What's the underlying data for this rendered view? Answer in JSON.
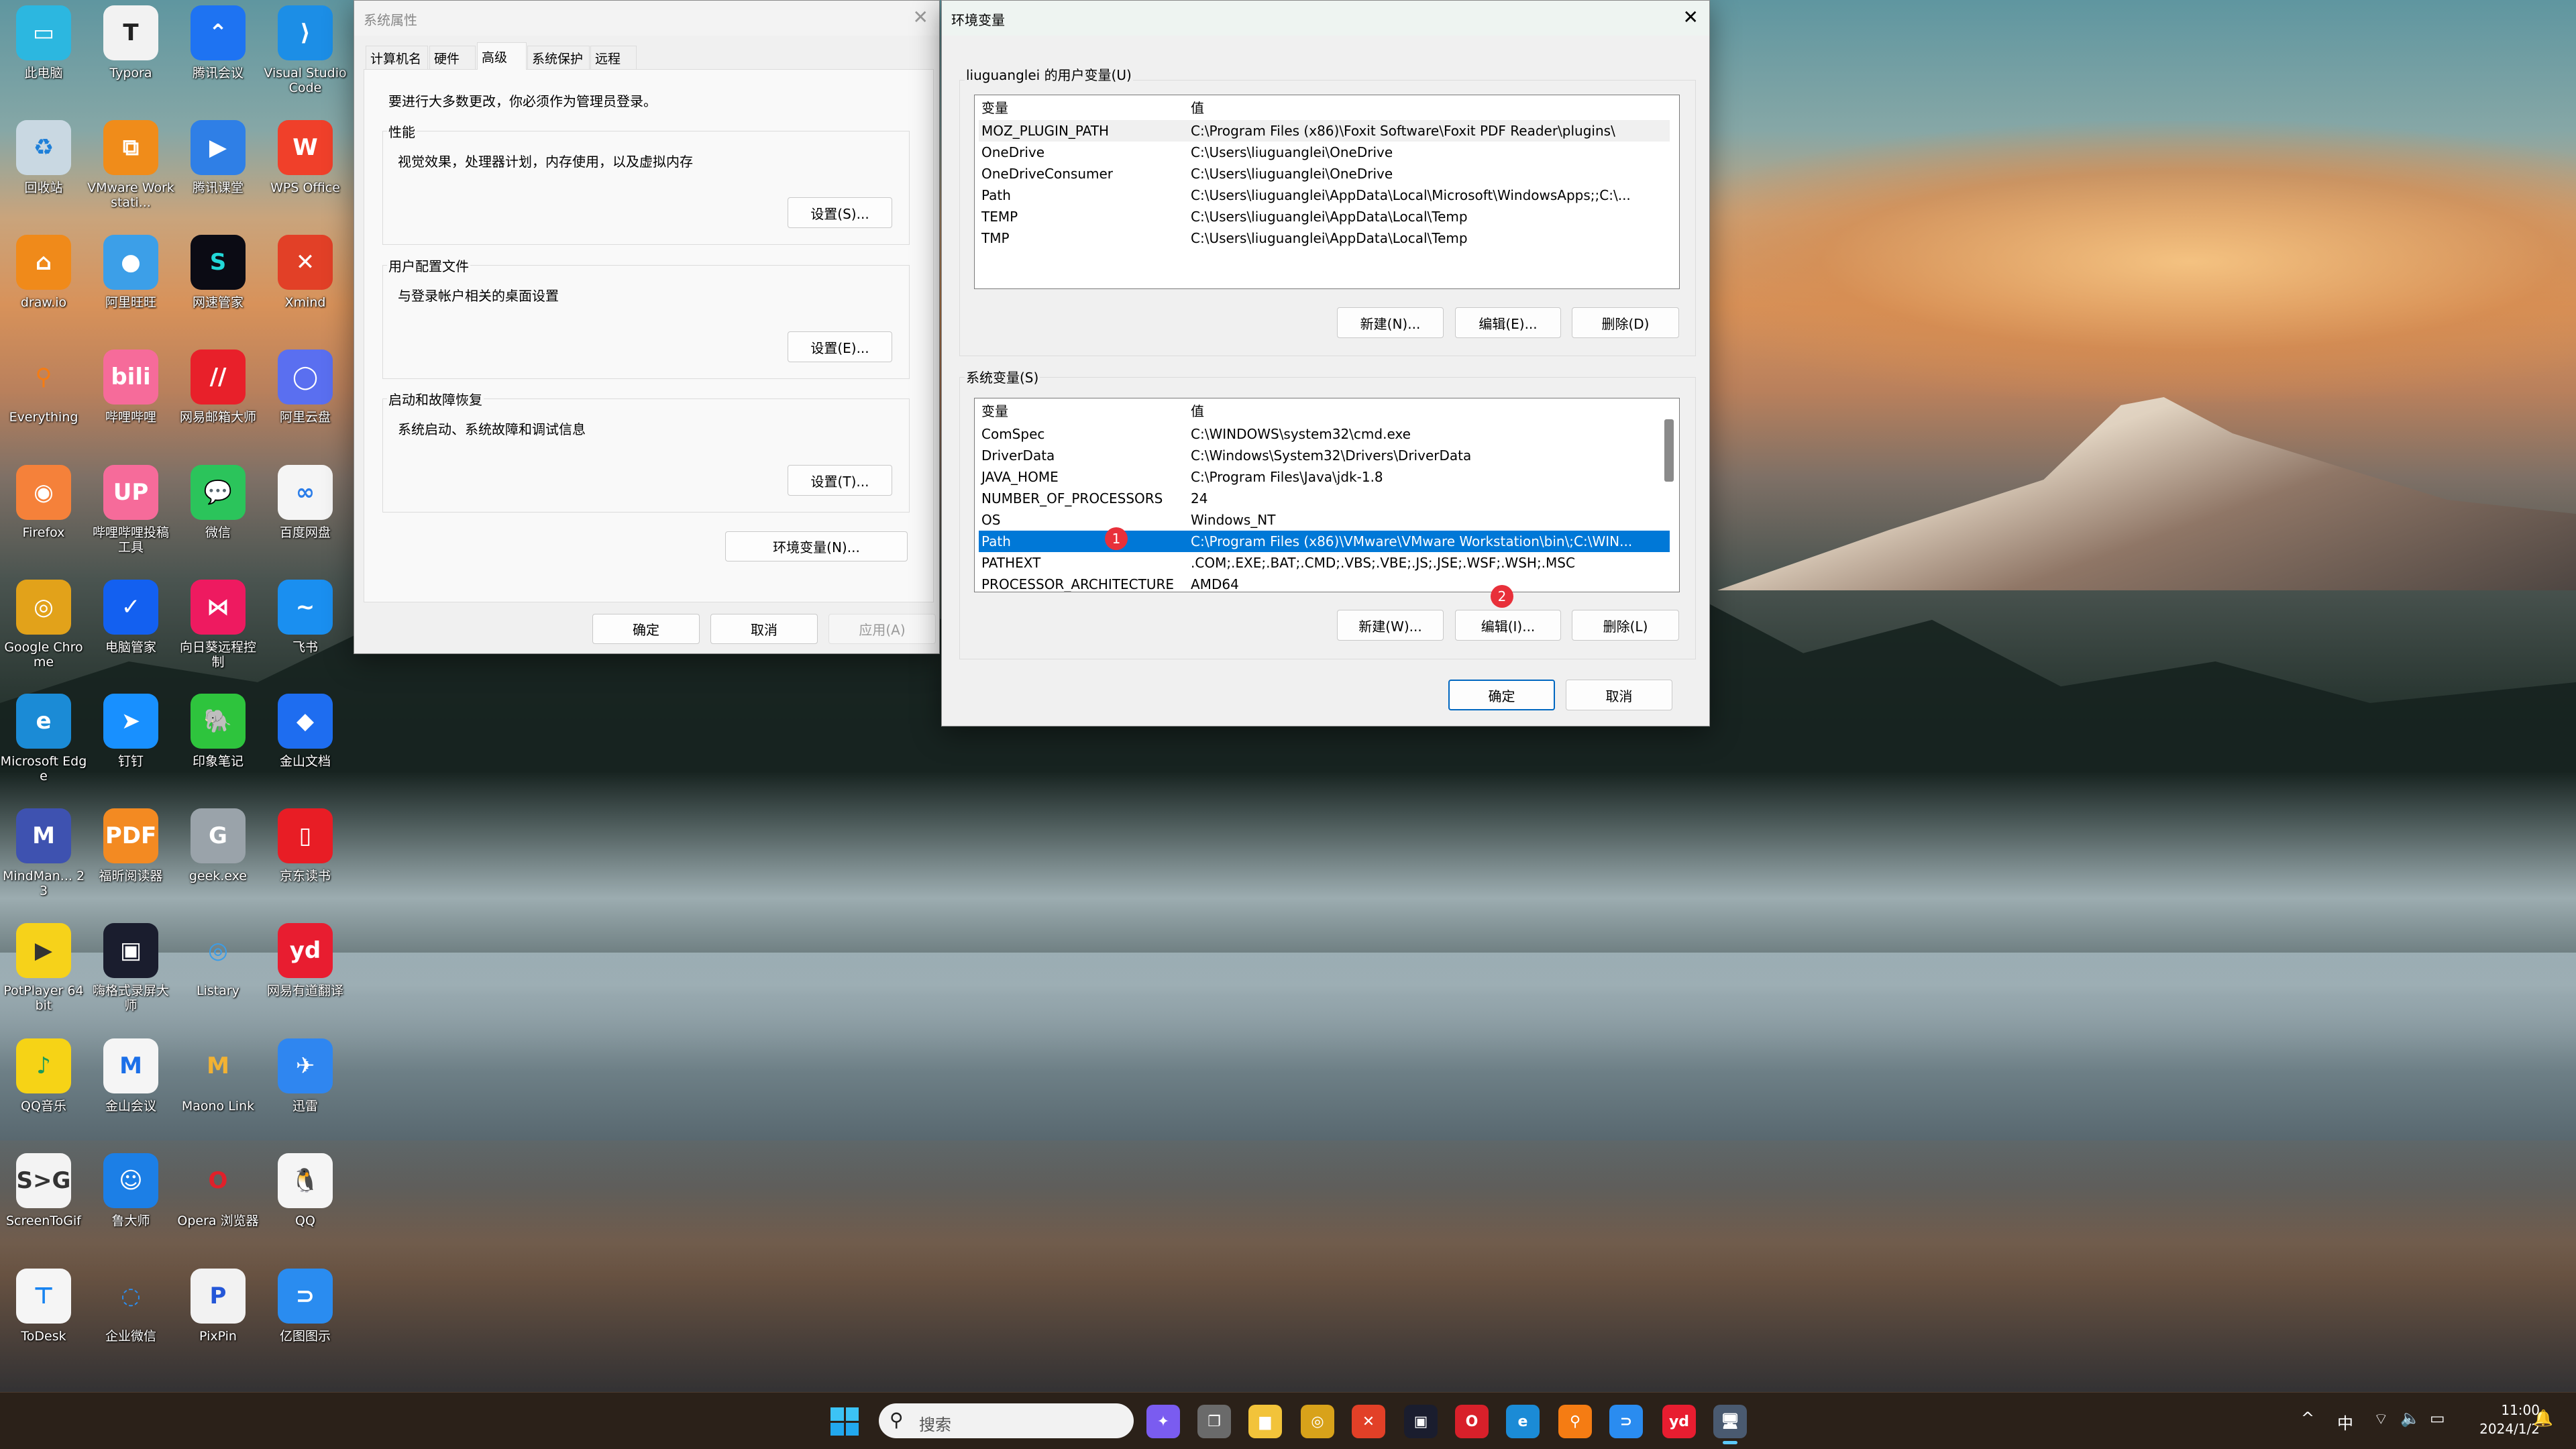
{
  "desktop": {
    "icons": [
      {
        "label": "此电脑",
        "glyph": "▭",
        "color": "#2cb7e0"
      },
      {
        "label": "Typora",
        "glyph": "T",
        "color": "#f2f2f2",
        "fg": "#222"
      },
      {
        "label": "腾讯会议",
        "glyph": "⌃",
        "color": "#1e73f2"
      },
      {
        "label": "Visual Studio Code",
        "glyph": "⟩",
        "color": "#1c8ee6"
      },
      {
        "label": "回收站",
        "glyph": "♻",
        "color": "#c9d8e2",
        "fg": "#1e7fd8"
      },
      {
        "label": "VMware Workstati...",
        "glyph": "⧉",
        "color": "#f08c1a"
      },
      {
        "label": "腾讯课堂",
        "glyph": "▶",
        "color": "#2f7fe6"
      },
      {
        "label": "WPS Office",
        "glyph": "W",
        "color": "#f0402a"
      },
      {
        "label": "draw.io",
        "glyph": "⌂",
        "color": "#f08a1a"
      },
      {
        "label": "阿里旺旺",
        "glyph": "●",
        "color": "#3c9fe8"
      },
      {
        "label": "网速管家",
        "glyph": "S",
        "color": "#0b0b14",
        "fg": "#22d8d8"
      },
      {
        "label": "Xmind",
        "glyph": "✕",
        "color": "#e24027"
      },
      {
        "label": "Everything",
        "glyph": "⚲",
        "color": "transparent",
        "fg": "#f57c13"
      },
      {
        "label": "哔哩哔哩",
        "glyph": "bili",
        "color": "#f66b9a"
      },
      {
        "label": "网易邮箱大师",
        "glyph": "//",
        "color": "#e8202a"
      },
      {
        "label": "阿里云盘",
        "glyph": "◯",
        "color": "#5a6ff0"
      },
      {
        "label": "Firefox",
        "glyph": "◉",
        "color": "#f5813a"
      },
      {
        "label": "哔哩哔哩投稿工具",
        "glyph": "UP",
        "color": "#f66b9a"
      },
      {
        "label": "微信",
        "glyph": "💬",
        "color": "#2bc45b"
      },
      {
        "label": "百度网盘",
        "glyph": "∞",
        "color": "#f5f5f5",
        "fg": "#2b7de9"
      },
      {
        "label": "Google Chrome",
        "glyph": "◎",
        "color": "#e2a21a"
      },
      {
        "label": "电脑管家",
        "glyph": "✓",
        "color": "#1360f0"
      },
      {
        "label": "向日葵远程控制",
        "glyph": "⋈",
        "color": "#ee1a60"
      },
      {
        "label": "飞书",
        "glyph": "~",
        "color": "#1a8ff0"
      },
      {
        "label": "Microsoft Edge",
        "glyph": "e",
        "color": "#1b8bd6"
      },
      {
        "label": "钉钉",
        "glyph": "➤",
        "color": "#1890ff"
      },
      {
        "label": "印象笔记",
        "glyph": "🐘",
        "color": "#2ec43d"
      },
      {
        "label": "金山文档",
        "glyph": "◆",
        "color": "#1e6df0"
      },
      {
        "label": "MindMan... 23",
        "glyph": "M",
        "color": "#3e52b0"
      },
      {
        "label": "福昕阅读器",
        "glyph": "PDF",
        "color": "#f38a22"
      },
      {
        "label": "geek.exe",
        "glyph": "G",
        "color": "#9aa3aa"
      },
      {
        "label": "京东读书",
        "glyph": "▯",
        "color": "#e81d25"
      },
      {
        "label": "PotPlayer 64 bit",
        "glyph": "▶",
        "color": "#f6d21a",
        "fg": "#333"
      },
      {
        "label": "嗨格式录屏大师",
        "glyph": "▣",
        "color": "#1a1d2e"
      },
      {
        "label": "Listary",
        "glyph": "◎",
        "color": "transparent",
        "fg": "#3b9de8"
      },
      {
        "label": "网易有道翻译",
        "glyph": "yd",
        "color": "#e81d30"
      },
      {
        "label": "QQ音乐",
        "glyph": "♪",
        "color": "#f6d316",
        "fg": "#1a9b5a"
      },
      {
        "label": "金山会议",
        "glyph": "M",
        "color": "#f5f5f5",
        "fg": "#1b6fe8"
      },
      {
        "label": "Maono Link",
        "glyph": "M",
        "color": "transparent",
        "fg": "#f2b233"
      },
      {
        "label": "迅雷",
        "glyph": "✈",
        "color": "#2f86f0"
      },
      {
        "label": "ScreenToGif",
        "glyph": "S>G",
        "color": "#f3f3f3",
        "fg": "#333"
      },
      {
        "label": "鲁大师",
        "glyph": "☺",
        "color": "#1c7fe6"
      },
      {
        "label": "Opera 浏览器",
        "glyph": "O",
        "color": "transparent",
        "fg": "#e0202a"
      },
      {
        "label": "QQ",
        "glyph": "🐧",
        "color": "#f5f5f5",
        "fg": "#111"
      },
      {
        "label": "ToDesk",
        "glyph": "⊤",
        "color": "#f5f5f5",
        "fg": "#1783f0"
      },
      {
        "label": "企业微信",
        "glyph": "◌",
        "color": "transparent",
        "fg": "#2b8ef0"
      },
      {
        "label": "PixPin",
        "glyph": "P",
        "color": "#f2f2f2",
        "fg": "#2457d8"
      },
      {
        "label": "亿图图示",
        "glyph": "⊃",
        "color": "#2a8cf0"
      }
    ]
  },
  "sysprops": {
    "title": "系统属性",
    "tabs": [
      "计算机名",
      "硬件",
      "高级",
      "系统保护",
      "远程"
    ],
    "active_tab": "高级",
    "admin_note": "要进行大多数更改，你必须作为管理员登录。",
    "groups": [
      {
        "label": "性能",
        "desc": "视觉效果，处理器计划，内存使用，以及虚拟内存",
        "button": "设置(S)..."
      },
      {
        "label": "用户配置文件",
        "desc": "与登录帐户相关的桌面设置",
        "button": "设置(E)..."
      },
      {
        "label": "启动和故障恢复",
        "desc": "系统启动、系统故障和调试信息",
        "button": "设置(T)..."
      }
    ],
    "env_button": "环境变量(N)...",
    "ok": "确定",
    "cancel": "取消",
    "apply": "应用(A)"
  },
  "envvars": {
    "title": "环境变量",
    "user_group": "liuguanglei 的用户变量(U)",
    "sys_group": "系统变量(S)",
    "col_var": "变量",
    "col_val": "值",
    "user_rows": [
      [
        "MOZ_PLUGIN_PATH",
        "C:\\Program Files (x86)\\Foxit Software\\Foxit PDF Reader\\plugins\\"
      ],
      [
        "OneDrive",
        "C:\\Users\\liuguanglei\\OneDrive"
      ],
      [
        "OneDriveConsumer",
        "C:\\Users\\liuguanglei\\OneDrive"
      ],
      [
        "Path",
        "C:\\Users\\liuguanglei\\AppData\\Local\\Microsoft\\WindowsApps;;C:\\..."
      ],
      [
        "TEMP",
        "C:\\Users\\liuguanglei\\AppData\\Local\\Temp"
      ],
      [
        "TMP",
        "C:\\Users\\liuguanglei\\AppData\\Local\\Temp"
      ]
    ],
    "sys_rows": [
      [
        "ComSpec",
        "C:\\WINDOWS\\system32\\cmd.exe"
      ],
      [
        "DriverData",
        "C:\\Windows\\System32\\Drivers\\DriverData"
      ],
      [
        "JAVA_HOME",
        "C:\\Program Files\\Java\\jdk-1.8"
      ],
      [
        "NUMBER_OF_PROCESSORS",
        "24"
      ],
      [
        "OS",
        "Windows_NT"
      ],
      [
        "Path",
        "C:\\Program Files (x86)\\VMware\\VMware Workstation\\bin\\;C:\\WIN..."
      ],
      [
        "PATHEXT",
        ".COM;.EXE;.BAT;.CMD;.VBS;.VBE;.JS;.JSE;.WSF;.WSH;.MSC"
      ],
      [
        "PROCESSOR_ARCHITECTURE",
        "AMD64"
      ]
    ],
    "selected_sys_row": "Path",
    "user_buttons": [
      "新建(N)...",
      "编辑(E)...",
      "删除(D)"
    ],
    "sys_buttons": [
      "新建(W)...",
      "编辑(I)...",
      "删除(L)"
    ],
    "ok": "确定",
    "cancel": "取消",
    "badge1": "1",
    "badge2": "2"
  },
  "taskbar": {
    "search_placeholder": "搜索",
    "apps": [
      {
        "name": "copilot",
        "glyph": "✦",
        "color": "#7a5cf0"
      },
      {
        "name": "task-view",
        "glyph": "❐",
        "color": "#6a6a6a"
      },
      {
        "name": "file-explorer",
        "glyph": "▆",
        "color": "#f2c33a"
      },
      {
        "name": "chrome",
        "glyph": "◎",
        "color": "#d8a21a"
      },
      {
        "name": "xmind",
        "glyph": "✕",
        "color": "#e24027"
      },
      {
        "name": "screen-recorder",
        "glyph": "▣",
        "color": "#1a1d2e"
      },
      {
        "name": "opera",
        "glyph": "O",
        "color": "#d8202a"
      },
      {
        "name": "edge",
        "glyph": "e",
        "color": "#1b8bd6"
      },
      {
        "name": "everything",
        "glyph": "⚲",
        "color": "#f57c13"
      },
      {
        "name": "edraw",
        "glyph": "⊃",
        "color": "#2a8cf0"
      },
      {
        "name": "youdao",
        "glyph": "yd",
        "color": "#e81d30"
      },
      {
        "name": "system-properties",
        "glyph": "🖥",
        "color": "#4a5a70"
      }
    ],
    "tray": {
      "ime": "中",
      "time": "11:00",
      "date": "2024/1/2"
    }
  }
}
